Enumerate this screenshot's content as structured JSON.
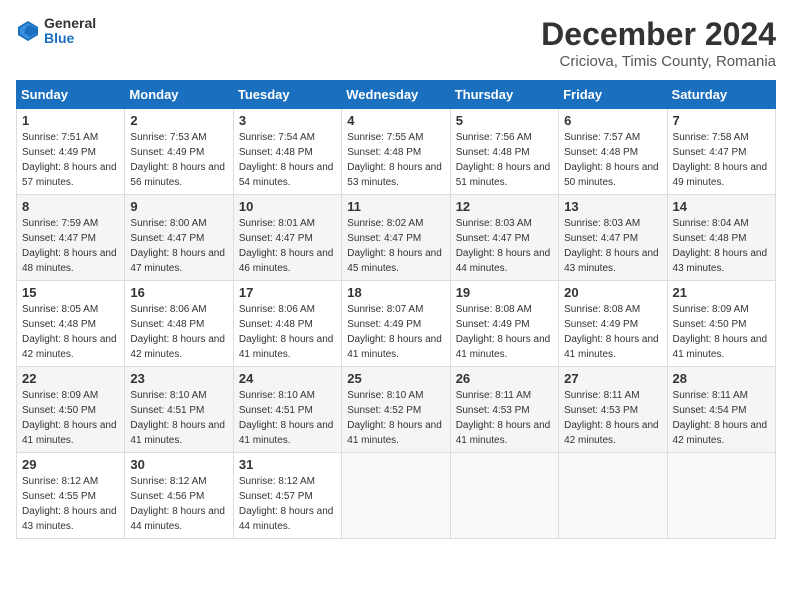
{
  "header": {
    "logo_general": "General",
    "logo_blue": "Blue",
    "month_title": "December 2024",
    "location": "Criciova, Timis County, Romania"
  },
  "days_of_week": [
    "Sunday",
    "Monday",
    "Tuesday",
    "Wednesday",
    "Thursday",
    "Friday",
    "Saturday"
  ],
  "weeks": [
    [
      {
        "day": "1",
        "sunrise": "7:51 AM",
        "sunset": "4:49 PM",
        "daylight": "8 hours and 57 minutes."
      },
      {
        "day": "2",
        "sunrise": "7:53 AM",
        "sunset": "4:49 PM",
        "daylight": "8 hours and 56 minutes."
      },
      {
        "day": "3",
        "sunrise": "7:54 AM",
        "sunset": "4:48 PM",
        "daylight": "8 hours and 54 minutes."
      },
      {
        "day": "4",
        "sunrise": "7:55 AM",
        "sunset": "4:48 PM",
        "daylight": "8 hours and 53 minutes."
      },
      {
        "day": "5",
        "sunrise": "7:56 AM",
        "sunset": "4:48 PM",
        "daylight": "8 hours and 51 minutes."
      },
      {
        "day": "6",
        "sunrise": "7:57 AM",
        "sunset": "4:48 PM",
        "daylight": "8 hours and 50 minutes."
      },
      {
        "day": "7",
        "sunrise": "7:58 AM",
        "sunset": "4:47 PM",
        "daylight": "8 hours and 49 minutes."
      }
    ],
    [
      {
        "day": "8",
        "sunrise": "7:59 AM",
        "sunset": "4:47 PM",
        "daylight": "8 hours and 48 minutes."
      },
      {
        "day": "9",
        "sunrise": "8:00 AM",
        "sunset": "4:47 PM",
        "daylight": "8 hours and 47 minutes."
      },
      {
        "day": "10",
        "sunrise": "8:01 AM",
        "sunset": "4:47 PM",
        "daylight": "8 hours and 46 minutes."
      },
      {
        "day": "11",
        "sunrise": "8:02 AM",
        "sunset": "4:47 PM",
        "daylight": "8 hours and 45 minutes."
      },
      {
        "day": "12",
        "sunrise": "8:03 AM",
        "sunset": "4:47 PM",
        "daylight": "8 hours and 44 minutes."
      },
      {
        "day": "13",
        "sunrise": "8:03 AM",
        "sunset": "4:47 PM",
        "daylight": "8 hours and 43 minutes."
      },
      {
        "day": "14",
        "sunrise": "8:04 AM",
        "sunset": "4:48 PM",
        "daylight": "8 hours and 43 minutes."
      }
    ],
    [
      {
        "day": "15",
        "sunrise": "8:05 AM",
        "sunset": "4:48 PM",
        "daylight": "8 hours and 42 minutes."
      },
      {
        "day": "16",
        "sunrise": "8:06 AM",
        "sunset": "4:48 PM",
        "daylight": "8 hours and 42 minutes."
      },
      {
        "day": "17",
        "sunrise": "8:06 AM",
        "sunset": "4:48 PM",
        "daylight": "8 hours and 41 minutes."
      },
      {
        "day": "18",
        "sunrise": "8:07 AM",
        "sunset": "4:49 PM",
        "daylight": "8 hours and 41 minutes."
      },
      {
        "day": "19",
        "sunrise": "8:08 AM",
        "sunset": "4:49 PM",
        "daylight": "8 hours and 41 minutes."
      },
      {
        "day": "20",
        "sunrise": "8:08 AM",
        "sunset": "4:49 PM",
        "daylight": "8 hours and 41 minutes."
      },
      {
        "day": "21",
        "sunrise": "8:09 AM",
        "sunset": "4:50 PM",
        "daylight": "8 hours and 41 minutes."
      }
    ],
    [
      {
        "day": "22",
        "sunrise": "8:09 AM",
        "sunset": "4:50 PM",
        "daylight": "8 hours and 41 minutes."
      },
      {
        "day": "23",
        "sunrise": "8:10 AM",
        "sunset": "4:51 PM",
        "daylight": "8 hours and 41 minutes."
      },
      {
        "day": "24",
        "sunrise": "8:10 AM",
        "sunset": "4:51 PM",
        "daylight": "8 hours and 41 minutes."
      },
      {
        "day": "25",
        "sunrise": "8:10 AM",
        "sunset": "4:52 PM",
        "daylight": "8 hours and 41 minutes."
      },
      {
        "day": "26",
        "sunrise": "8:11 AM",
        "sunset": "4:53 PM",
        "daylight": "8 hours and 41 minutes."
      },
      {
        "day": "27",
        "sunrise": "8:11 AM",
        "sunset": "4:53 PM",
        "daylight": "8 hours and 42 minutes."
      },
      {
        "day": "28",
        "sunrise": "8:11 AM",
        "sunset": "4:54 PM",
        "daylight": "8 hours and 42 minutes."
      }
    ],
    [
      {
        "day": "29",
        "sunrise": "8:12 AM",
        "sunset": "4:55 PM",
        "daylight": "8 hours and 43 minutes."
      },
      {
        "day": "30",
        "sunrise": "8:12 AM",
        "sunset": "4:56 PM",
        "daylight": "8 hours and 44 minutes."
      },
      {
        "day": "31",
        "sunrise": "8:12 AM",
        "sunset": "4:57 PM",
        "daylight": "8 hours and 44 minutes."
      },
      null,
      null,
      null,
      null
    ]
  ]
}
